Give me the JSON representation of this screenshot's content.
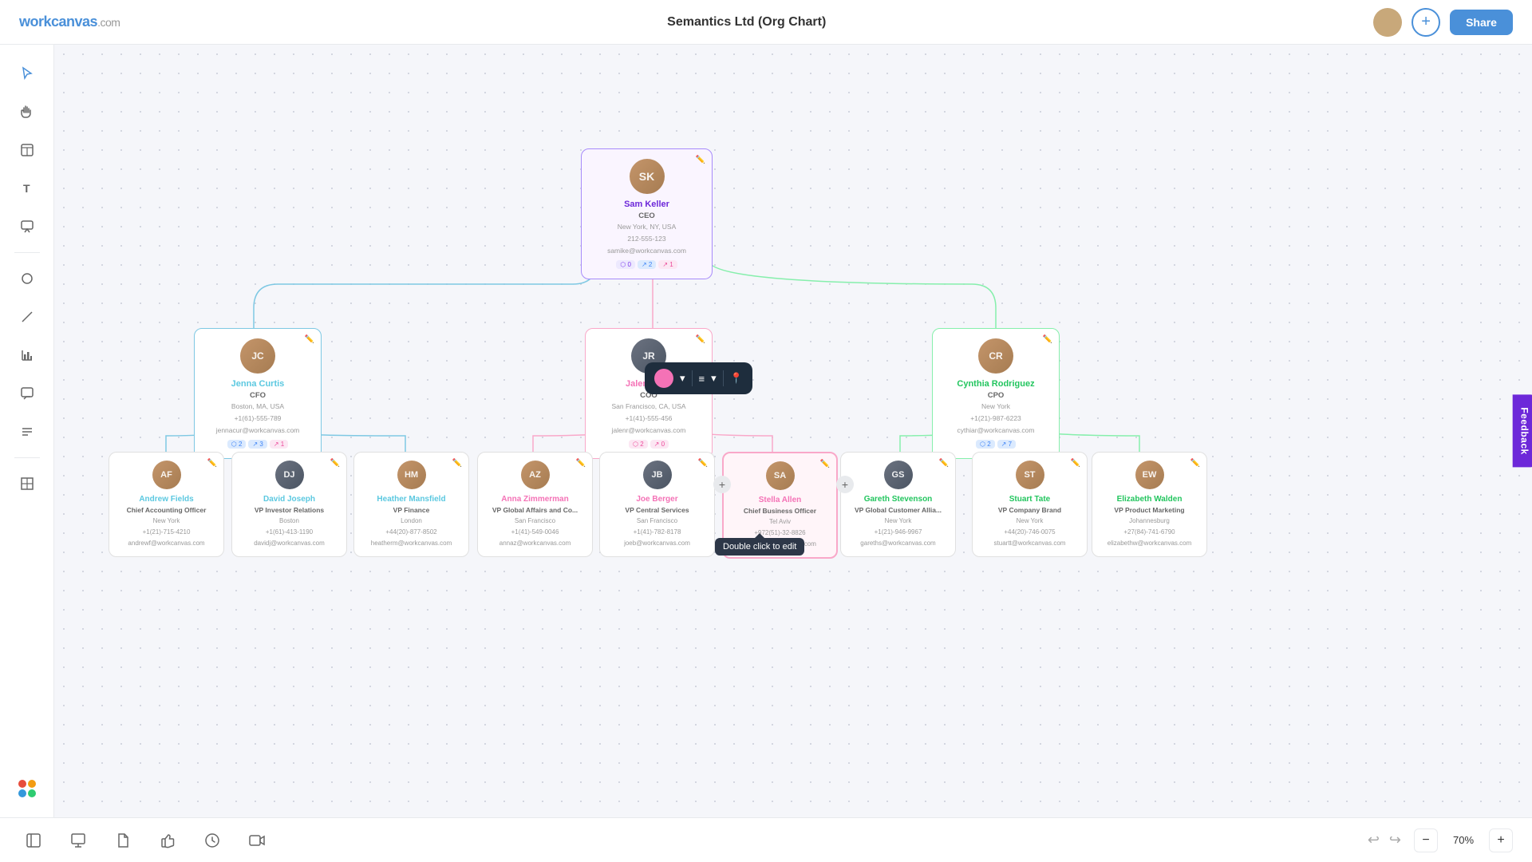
{
  "app": {
    "name": "workcanvas",
    "domain": ".com",
    "title": "Semantics Ltd (Org Chart)",
    "share_label": "Share",
    "add_btn_icon": "+"
  },
  "toolbar": {
    "float": {
      "circle_color": "#f472b6",
      "lines_icon": "≡",
      "pin_icon": "📍"
    }
  },
  "zoom": {
    "level": "70%",
    "minus": "−",
    "plus": "+"
  },
  "nodes": {
    "ceo": {
      "name": "Sam Keller",
      "title": "CEO",
      "location": "New York, NY, USA",
      "phone": "212-555-123",
      "email": "samike@workcanvas.com",
      "initials": "SK",
      "badge1": "⬡ 0",
      "badge2": "↗ 2",
      "badge3": "↗ 1"
    },
    "cfo": {
      "name": "Jenna Curtis",
      "title": "CFO",
      "location": "Boston, MA, USA",
      "phone": "+1(61)-555-789",
      "email": "jennacur@workcanvas.com",
      "initials": "JC",
      "badge1": "⬡ 2",
      "badge2": "↗ 3",
      "badge3": "↗ 1"
    },
    "coo": {
      "name": "Jalen Reed",
      "title": "COO",
      "location": "San Francisco, CA, USA",
      "phone": "+1(41)-555-456",
      "email": "jalenr@workcanvas.com",
      "initials": "JR",
      "badge1": "⬡ 2",
      "badge2": "↗ 0"
    },
    "cpo": {
      "name": "Cynthia Rodriguez",
      "title": "CPO",
      "location": "New York",
      "phone": "+1(21)-987-6223",
      "email": "cythiar@workcanvas.com",
      "initials": "CR",
      "badge1": "⬡ 2",
      "badge2": "↗ 7"
    },
    "andrew": {
      "name": "Andrew Fields",
      "title": "Chief Accounting Officer",
      "location": "New York",
      "phone": "+1(21)-715-4210",
      "email": "andrewf@workcanvas.com",
      "initials": "AF"
    },
    "david": {
      "name": "David Joseph",
      "title": "VP Investor Relations",
      "location": "Boston",
      "phone": "+1(61)-413-1190",
      "email": "davidj@workcanvas.com",
      "initials": "DJ"
    },
    "heather": {
      "name": "Heather Mansfield",
      "title": "VP Finance",
      "location": "London",
      "phone": "+44(20)-877-8502",
      "email": "heatherm@workcanvas.com",
      "initials": "HM"
    },
    "anna": {
      "name": "Anna Zimmerman",
      "title": "VP Global Affairs and Co...",
      "location": "San Francisco",
      "phone": "+1(41)-549-0046",
      "email": "annaz@workcanvas.com",
      "initials": "AZ"
    },
    "joe": {
      "name": "Joe Berger",
      "title": "VP Central Services",
      "location": "San Francisco",
      "phone": "+1(41)-782-8178",
      "email": "joeb@workcanvas.com",
      "initials": "JB"
    },
    "stella": {
      "name": "Stella Allen",
      "title": "Chief Business Officer",
      "location": "Tel Aviv",
      "phone": "+972(51)-32-8826",
      "email": "stellaa@workcanvas.com",
      "initials": "SA",
      "tooltip": "Double click to edit"
    },
    "gareth": {
      "name": "Gareth Stevenson",
      "title": "VP Global Customer Allia...",
      "location": "New York",
      "phone": "+1(21)-946-9967",
      "email": "gareths@workcanvas.com",
      "initials": "GS"
    },
    "stuart": {
      "name": "Stuart Tate",
      "title": "VP Company Brand",
      "location": "New York",
      "phone": "+44(20)-746-0075",
      "email": "stuartt@workcanvas.com",
      "initials": "ST"
    },
    "elizabeth": {
      "name": "Elizabeth Walden",
      "title": "VP Product Marketing",
      "location": "Johannesburg",
      "phone": "+27(84)-741-6790",
      "email": "elizabethw@workcanvas.com",
      "initials": "EW"
    }
  },
  "sidebar": {
    "icons": [
      "cursor",
      "hand",
      "table",
      "text",
      "annotation",
      "shape",
      "line",
      "chart",
      "chat",
      "list",
      "logo"
    ]
  },
  "bottombar": {
    "icons": [
      "sidebar",
      "presentation",
      "file",
      "thumbs-up",
      "clock",
      "video"
    ],
    "undo": "↩",
    "redo": "↪"
  }
}
